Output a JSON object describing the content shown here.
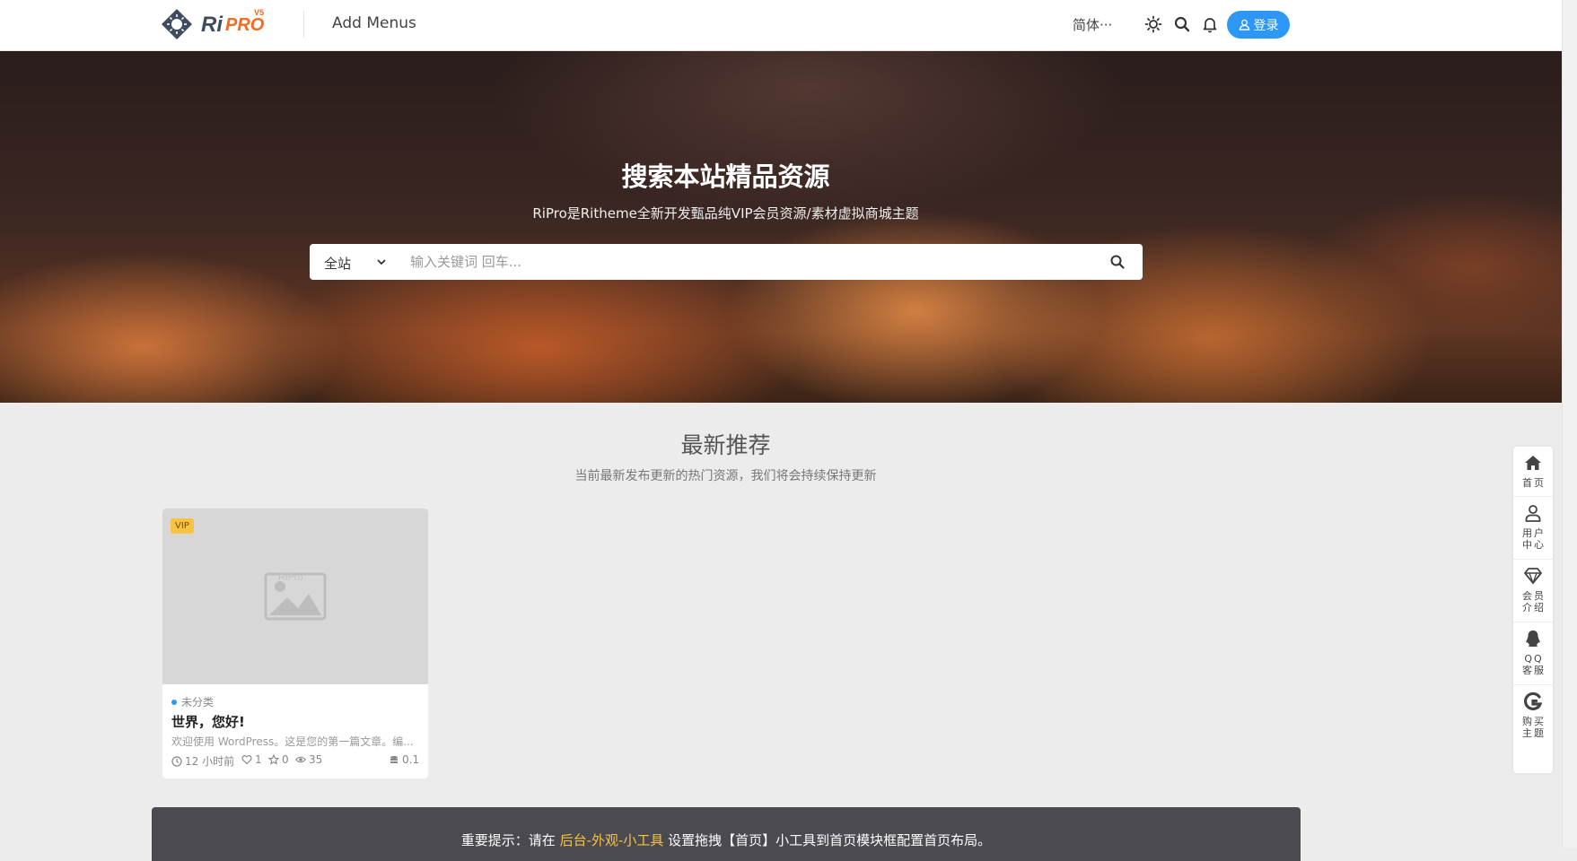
{
  "header": {
    "logo_text": "RiPRO",
    "logo_badge": "V5",
    "menu_label": "Add Menus",
    "language": "简体···",
    "login_label": "登录",
    "icons": [
      "theme-toggle-icon",
      "search-icon",
      "bell-icon",
      "user-icon"
    ]
  },
  "hero": {
    "title": "搜索本站精品资源",
    "subtitle": "RiPro是Ritheme全新开发甄品纯VIP会员资源/素材虚拟商城主题",
    "search_scope": "全站",
    "search_placeholder": "输入关键词 回车..."
  },
  "section": {
    "title": "最新推荐",
    "subtitle": "当前最新发布更新的热门资源，我们将会持续保持更新"
  },
  "card": {
    "badge": "VIP",
    "placeholder_label": "RiPro",
    "category": "未分类",
    "title": "世界，您好!",
    "excerpt": "欢迎使用 WordPress。这是您的第一篇文章。编...",
    "time": "12 小时前",
    "likes": "1",
    "favorites": "0",
    "views": "35",
    "price": "0.1"
  },
  "notice": {
    "prefix": "重要提示：请在 ",
    "link": "后台-外观-小工具",
    "suffix": " 设置拖拽【首页】小工具到首页模块框配置首页布局。"
  },
  "sidebar": {
    "items": [
      {
        "label": "首页",
        "icon": "home-icon"
      },
      {
        "label": "用户中心",
        "icon": "user-icon"
      },
      {
        "label": "会员介绍",
        "icon": "diamond-icon"
      },
      {
        "label": "QQ客服",
        "icon": "qq-icon"
      },
      {
        "label": "购买主题",
        "icon": "theme-logo-icon"
      }
    ]
  },
  "colors": {
    "accent": "#2d97f6",
    "vip": "#f6c343",
    "notice_bg": "#4a4a50"
  }
}
